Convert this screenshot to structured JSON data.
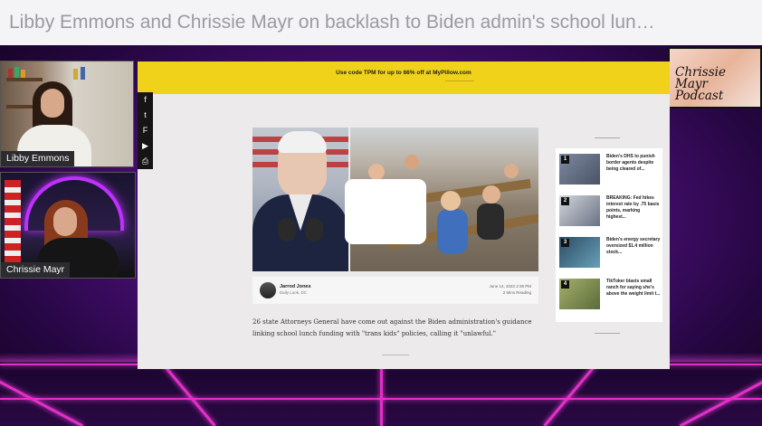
{
  "video": {
    "title": "Libby Emmons and Chrissie Mayr on backlash to Biden admin's school lun…"
  },
  "cams": [
    {
      "name": "Libby Emmons"
    },
    {
      "name": "Chrissie Mayr"
    }
  ],
  "logo": {
    "line1": "Chrissie",
    "line2": "Mayr",
    "line3": "Podcast"
  },
  "page": {
    "promo": "Use code TPM for up to 66% off at MyPillow.com",
    "share_icons": [
      "f-icon",
      "twitter-icon",
      "flipboard-icon",
      "rumble-icon",
      "print-icon"
    ],
    "share_glyphs": [
      "f",
      "t",
      "F",
      "▶",
      "⎙"
    ],
    "byline": {
      "author": "Jarrod Jones",
      "role": "Daily Look, DC",
      "date": "June 14, 2022 2:38 PM",
      "read_time": "2 Mins Reading"
    },
    "article_text": "26 state Attorneys General have come out against the Biden administration's guidance linking school lunch funding with \"trans kids\" policies, calling it \"unlawful.\"",
    "sidebar": [
      {
        "num": "1",
        "text": "Biden's DHS to punish border agents despite being cleared of..."
      },
      {
        "num": "2",
        "text": "BREAKING: Fed hikes interest rate by .75 basis points, marking highest..."
      },
      {
        "num": "3",
        "text": "Biden's energy secretary oversized $1.4 million stock..."
      },
      {
        "num": "4",
        "text": "TikToker blasts small ranch for saying she's above the weight limit t..."
      }
    ]
  },
  "colors": {
    "promo_bg": "#f1d21a",
    "neon": "#e030c8",
    "page_bg": "#eceaea"
  }
}
